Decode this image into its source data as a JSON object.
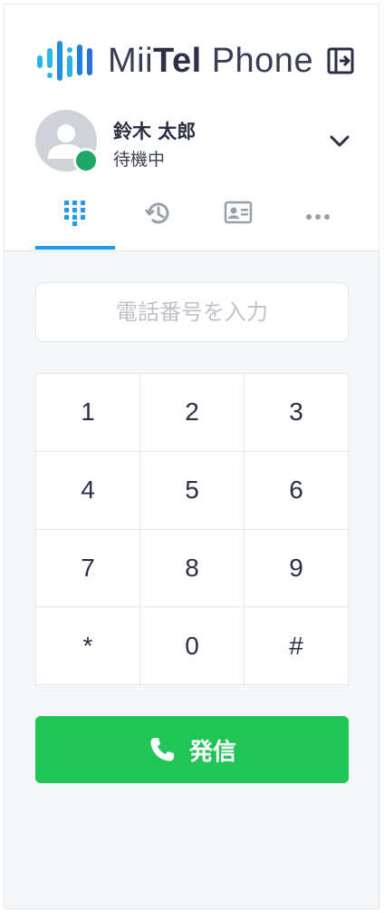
{
  "header": {
    "logo_light": "Mii",
    "logo_bold": "Tel",
    "logo_suffix": " Phone",
    "logo_icon": "soundwave-logo-icon",
    "exit_icon": "logout-icon"
  },
  "user": {
    "name": "鈴木 太郎",
    "status": "待機中",
    "status_color": "#1fa865",
    "toggle_icon": "chevron-down-icon"
  },
  "tabs": [
    {
      "icon": "dialpad-icon",
      "active": true
    },
    {
      "icon": "history-icon",
      "active": false
    },
    {
      "icon": "contact-card-icon",
      "active": false
    },
    {
      "icon": "more-icon",
      "active": false
    }
  ],
  "phone_input": {
    "placeholder": "電話番号を入力",
    "value": ""
  },
  "keypad": {
    "keys": [
      "1",
      "2",
      "3",
      "4",
      "5",
      "6",
      "7",
      "8",
      "9",
      "*",
      "0",
      "#"
    ]
  },
  "call_button": {
    "label": "発信",
    "icon": "phone-icon",
    "color": "#20c457"
  },
  "colors": {
    "accent": "#1e9bea",
    "text": "#2b2f45"
  }
}
